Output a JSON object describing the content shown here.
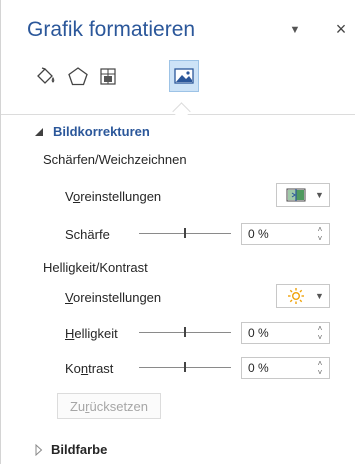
{
  "pane": {
    "title": "Grafik formatieren",
    "dropdown_icon": "chevron-down-icon",
    "close_symbol": "×"
  },
  "tabs": [
    {
      "name": "fill-line",
      "icon": "paint-bucket-icon",
      "active": false
    },
    {
      "name": "effects",
      "icon": "pentagon-icon",
      "active": false
    },
    {
      "name": "layout-properties",
      "icon": "layout-size-icon",
      "active": false
    },
    {
      "name": "picture",
      "icon": "picture-icon",
      "active": true
    }
  ],
  "bildkorrekturen": {
    "header": "Bildkorrekturen",
    "sharpen_group": {
      "title": "Schärfen/Weichzeichnen",
      "presets_prefix": "V",
      "presets_underlined": "o",
      "presets_rest": "reinstellungen",
      "sharpness_label": "Schärfe",
      "sharpness_value": "0 %",
      "sharpness_level": 0.5
    },
    "brightness_group": {
      "title": "Helligkeit/Kontrast",
      "presets_underlined": "V",
      "presets_rest": "oreinstellungen",
      "brightness_underlined": "H",
      "brightness_rest": "elligkeit",
      "brightness_value": "0 %",
      "brightness_level": 0.5,
      "contrast_prefix": "Ko",
      "contrast_underlined": "n",
      "contrast_rest": "trast",
      "contrast_value": "0 %",
      "contrast_level": 0.5
    },
    "reset_prefix": "Zu",
    "reset_underlined": "r",
    "reset_rest": "ücksetzen"
  },
  "bildfarbe": {
    "header": "Bildfarbe"
  },
  "colors": {
    "accent": "#2b579a",
    "active_tab": "#cde3f7",
    "sun": "#f0a30a"
  }
}
